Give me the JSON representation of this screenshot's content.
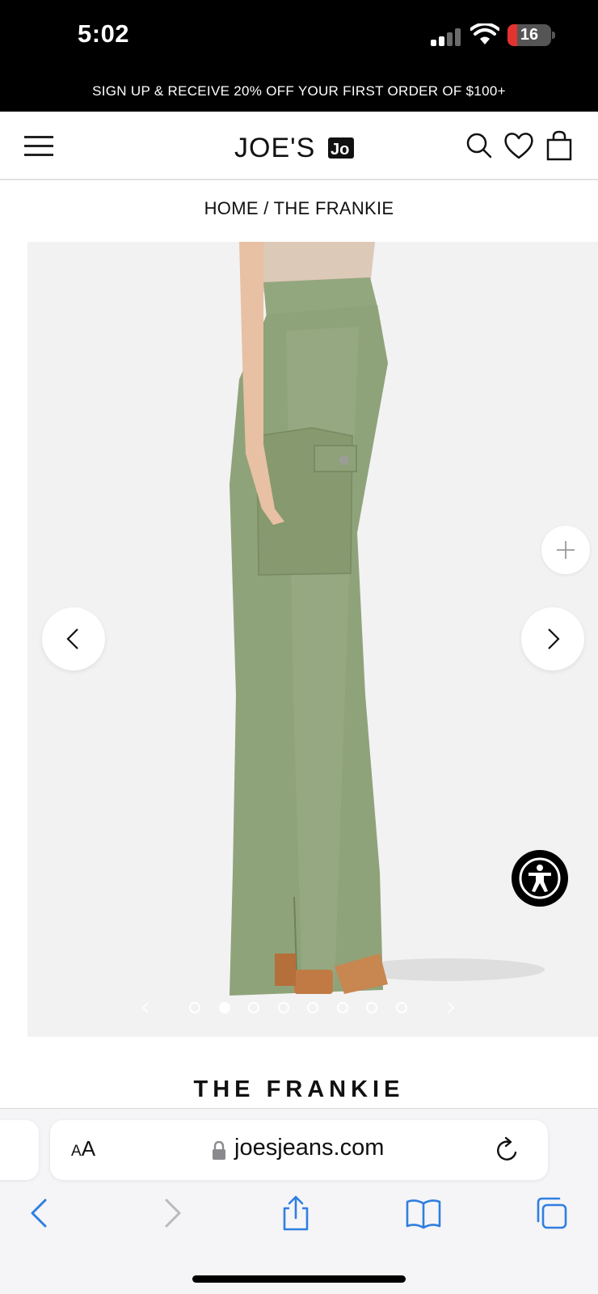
{
  "status_bar": {
    "time": "5:02",
    "battery": "16",
    "signal_bars": 2,
    "signal_total": 4
  },
  "promo": {
    "text": "SIGN UP & RECEIVE 20% OFF YOUR FIRST ORDER OF $100+"
  },
  "header": {
    "logo": "JOE'S",
    "icons": [
      "menu-icon",
      "search-icon",
      "heart-icon",
      "bag-icon"
    ]
  },
  "breadcrumb": {
    "home": "HOME",
    "separator": " / ",
    "current": "THE FRANKIE"
  },
  "gallery": {
    "image_count": 8,
    "active_index": 1,
    "colors": {
      "background": "#f2f2f3",
      "pants": "#8fa37a",
      "top": "#dcc9b8",
      "skin": "#e8c0a3",
      "heel": "#c17a43"
    }
  },
  "product": {
    "title": "THE FRANKIE"
  },
  "browser": {
    "aa_label": "AA",
    "url": "joesjeans.com",
    "accent": "#2f7fe0",
    "icons": [
      "back-icon",
      "forward-icon",
      "share-icon",
      "bookmarks-icon",
      "tabs-icon"
    ]
  }
}
